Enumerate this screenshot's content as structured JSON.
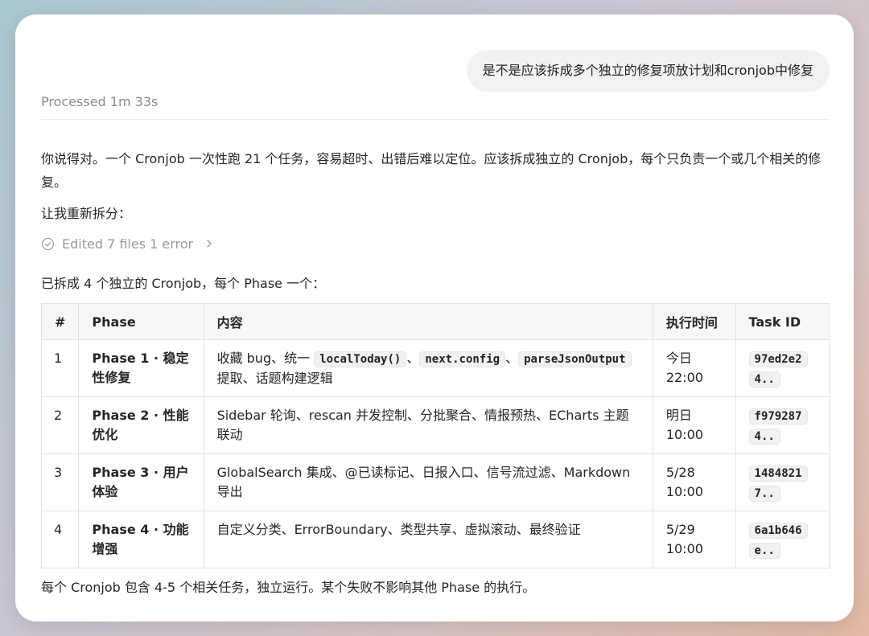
{
  "user_message": "是不是应该拆成多个独立的修复项放计划和cronjob中修复",
  "processed_label": "Processed 1m 33s",
  "intro_paragraph": "你说得对。一个 Cronjob 一次性跑 21 个任务，容易超时、出错后难以定位。应该拆成独立的 Cronjob，每个只负责一个或几个相关的修复。",
  "resplit_text": "让我重新拆分：",
  "edited_label": "Edited 7 files 1 error",
  "summary_text": "已拆成 4 个独立的 Cronjob，每个 Phase 一个：",
  "table": {
    "headers": [
      "#",
      "Phase",
      "内容",
      "执行时间",
      "Task ID"
    ],
    "rows": [
      {
        "num": "1",
        "phase": "Phase 1 · 稳定性修复",
        "content": {
          "prefix": "收藏 bug、统一 ",
          "code1": "localToday()",
          "sep1": "、",
          "code2": "next.config",
          "sep2": "、",
          "code3": "parseJsonOutput",
          "suffix": " 提取、话题构建逻辑"
        },
        "time_day": "今日",
        "time_clock": "22:00",
        "task_id": "97ed2e24.."
      },
      {
        "num": "2",
        "phase": "Phase 2 · 性能优化",
        "content": "Sidebar 轮询、rescan 并发控制、分批聚合、情报预热、ECharts 主题联动",
        "time_day": "明日",
        "time_clock": "10:00",
        "task_id": "f9792874.."
      },
      {
        "num": "3",
        "phase": "Phase 3 · 用户体验",
        "content": "GlobalSearch 集成、@已读标记、日报入口、信号流过滤、Markdown 导出",
        "time_day": "5/28",
        "time_clock": "10:00",
        "task_id": "14848217.."
      },
      {
        "num": "4",
        "phase": "Phase 4 · 功能增强",
        "content": "自定义分类、ErrorBoundary、类型共享、虚拟滚动、最终验证",
        "time_day": "5/29",
        "time_clock": "10:00",
        "task_id": "6a1b646e.."
      }
    ]
  },
  "footer_text": "每个 Cronjob 包含 4-5 个相关任务，独立运行。某个失败不影响其他 Phase 的执行。",
  "icons": {
    "edited": "check-circle-icon",
    "expand": "chevron-right-icon"
  }
}
